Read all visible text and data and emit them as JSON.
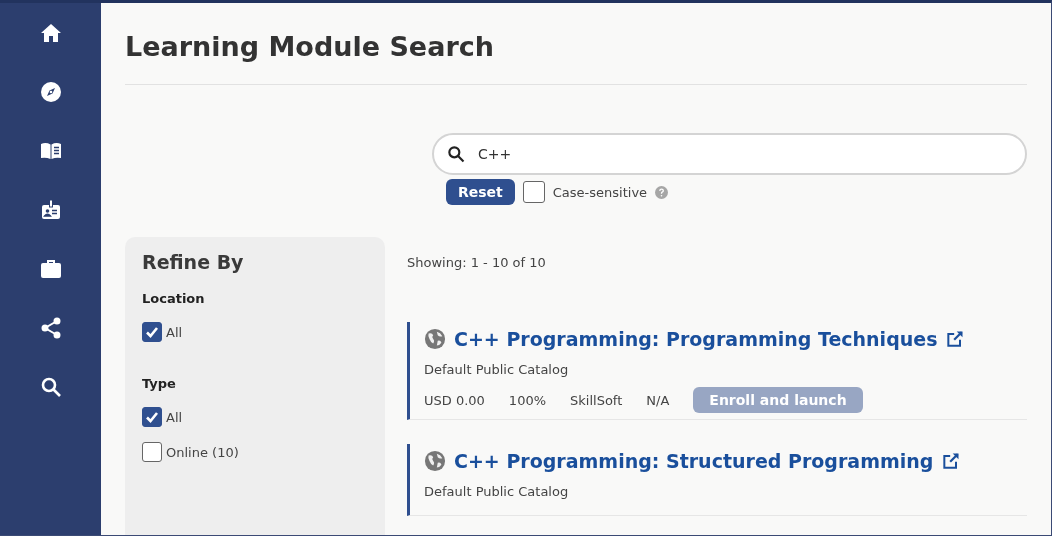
{
  "sidebar": {
    "items": [
      {
        "kind": "home"
      },
      {
        "kind": "compass"
      },
      {
        "kind": "book"
      },
      {
        "kind": "badge"
      },
      {
        "kind": "briefcase"
      },
      {
        "kind": "share"
      },
      {
        "kind": "search"
      }
    ]
  },
  "page": {
    "title": "Learning Module Search"
  },
  "search": {
    "value": "C++",
    "reset": "Reset",
    "case_sensitive": {
      "label": "Case-sensitive",
      "checked": false
    }
  },
  "refine": {
    "title": "Refine By",
    "groups": [
      {
        "title": "Location",
        "options": [
          {
            "label": "All",
            "checked": true
          }
        ]
      },
      {
        "title": "Type",
        "options": [
          {
            "label": "All",
            "checked": true
          },
          {
            "label": "Online (10)",
            "checked": false
          }
        ]
      }
    ]
  },
  "results": {
    "showing": "Showing: 1 - 10 of 10",
    "items": [
      {
        "title": "C++ Programming: Programming Techniques",
        "catalog": "Default Public Catalog",
        "price": "USD 0.00",
        "percent": "100%",
        "vendor": "SkillSoft",
        "column_4": "N/A",
        "action": {
          "label": "Enroll and launch",
          "disabled": true
        }
      },
      {
        "title": "C++ Programming: Structured Programming",
        "catalog": "Default Public Catalog"
      }
    ]
  }
}
